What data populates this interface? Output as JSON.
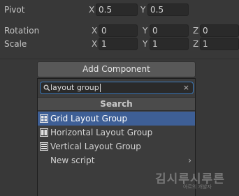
{
  "transform": {
    "pivot": {
      "label": "Pivot",
      "x_axis": "X",
      "x_value": "0.5",
      "y_axis": "Y",
      "y_value": "0.5"
    },
    "rotation": {
      "label": "Rotation",
      "x_axis": "X",
      "x_value": "0",
      "y_axis": "Y",
      "y_value": "0",
      "z_axis": "Z",
      "z_value": "0"
    },
    "scale": {
      "label": "Scale",
      "x_axis": "X",
      "x_value": "1",
      "y_axis": "Y",
      "y_value": "1",
      "z_axis": "Z",
      "z_value": "1"
    }
  },
  "add_component": {
    "button_label": "Add Component",
    "search": {
      "value": "layout group",
      "icon": "search-icon",
      "clear_icon": "close-icon",
      "clear_glyph": "×"
    },
    "section_header": "Search",
    "results": [
      {
        "label": "Grid Layout Group",
        "icon": "grid-layout-icon",
        "selected": true
      },
      {
        "label": "Horizontal Layout Group",
        "icon": "horizontal-layout-icon",
        "selected": false
      },
      {
        "label": "Vertical Layout Group",
        "icon": "vertical-layout-icon",
        "selected": false
      },
      {
        "label": "New script",
        "icon": "",
        "chevron": "›",
        "selected": false
      }
    ],
    "colors": {
      "selected_row": "#3e5f96",
      "search_focus_border": "#3a79bb"
    }
  },
  "watermark": {
    "title": "김시루시루른",
    "subtitle": "아르의 개발자"
  }
}
